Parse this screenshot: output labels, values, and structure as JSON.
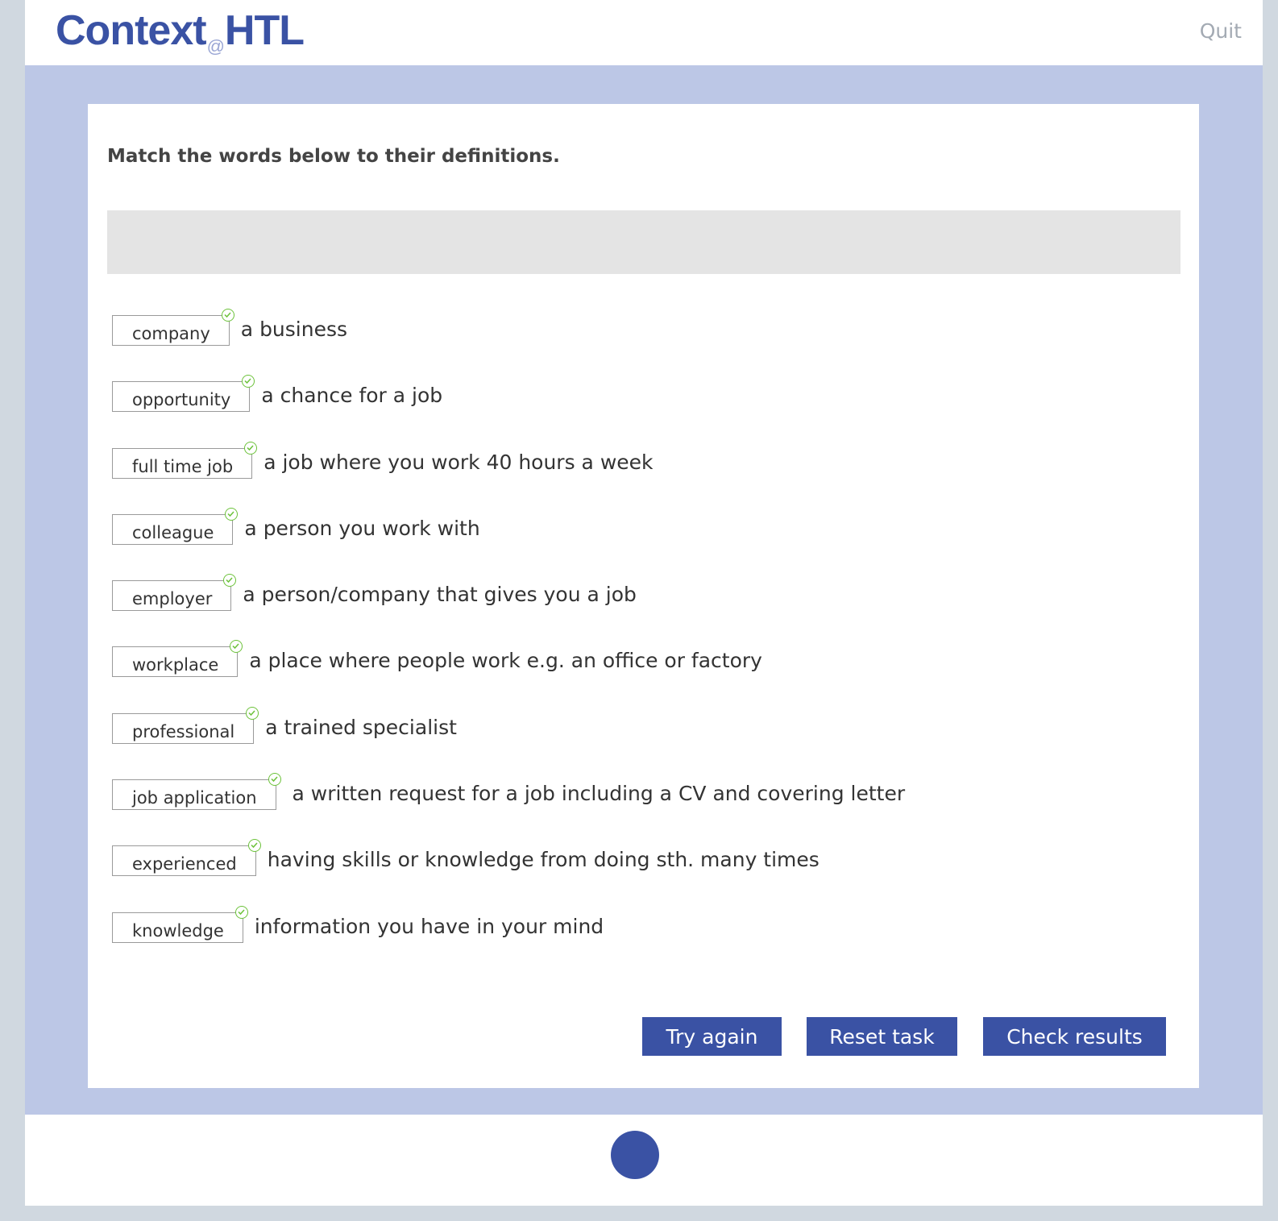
{
  "header": {
    "logo_part1": "Context",
    "logo_at": "@",
    "logo_part2": "HTL",
    "quit_label": "Quit"
  },
  "task": {
    "instruction": "Match the words below to their definitions.",
    "items": [
      {
        "word": "company",
        "definition": "a business",
        "status": "correct"
      },
      {
        "word": "opportunity",
        "definition": "a chance for a job",
        "status": "correct"
      },
      {
        "word": "full time job",
        "definition": "a job where you work 40 hours a week",
        "status": "correct"
      },
      {
        "word": "colleague",
        "definition": "a person you work with",
        "status": "correct"
      },
      {
        "word": "employer",
        "definition": "a person/company that gives you a job",
        "status": "correct"
      },
      {
        "word": "workplace",
        "definition": "a place where people work e.g. an office or factory",
        "status": "correct"
      },
      {
        "word": "professional",
        "definition": "a trained specialist",
        "status": "correct"
      },
      {
        "word": "job application",
        "definition": "a written request for a job including a CV and covering letter",
        "status": "correct"
      },
      {
        "word": "experienced",
        "definition": "having skills or knowledge from doing sth. many times",
        "status": "correct"
      },
      {
        "word": "knowledge",
        "definition": "information you have in your mind",
        "status": "correct"
      }
    ]
  },
  "buttons": {
    "try_again": "Try again",
    "reset_task": "Reset task",
    "check_results": "Check results"
  },
  "colors": {
    "brand": "#3a52a4",
    "background_band": "#bcc7e6",
    "correct": "#6cc23a"
  }
}
